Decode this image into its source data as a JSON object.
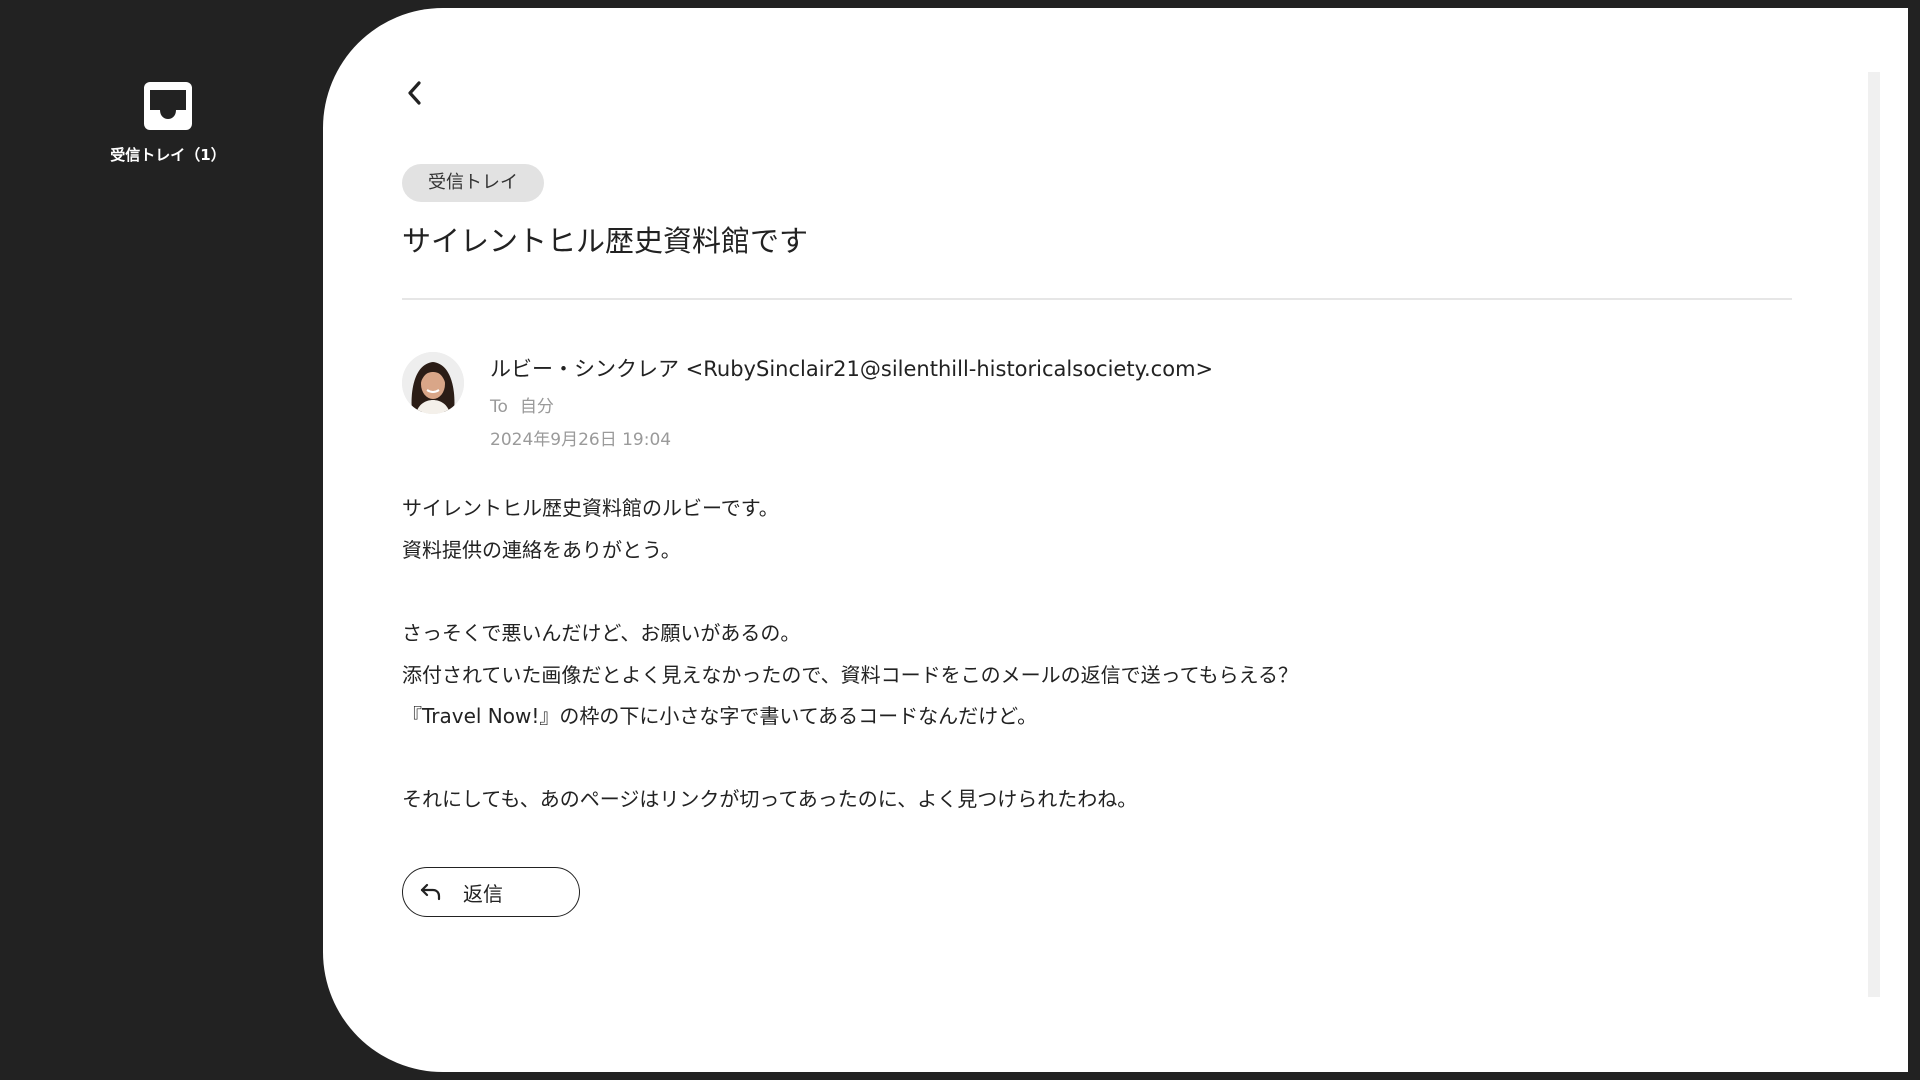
{
  "sidebar": {
    "inbox_label": "受信トレイ（1）"
  },
  "email": {
    "tag": "受信トレイ",
    "subject": "サイレントヒル歴史資料館です",
    "sender": "ルビー・シンクレア <RubySinclair21@silenthill-historicalsociety.com>",
    "to_prefix": "To",
    "to_recipient": "自分",
    "date": "2024年9月26日 19:04",
    "body": [
      "サイレントヒル歴史資料館のルビーです。",
      "資料提供の連絡をありがとう。",
      "",
      "さっそくで悪いんだけど、お願いがあるの。",
      "添付されていた画像だとよく見えなかったので、資料コードをこのメールの返信で送ってもらえる？",
      "『Travel Now!』の枠の下に小さな字で書いてあるコードなんだけど。",
      "",
      "それにしても、あのページはリンクが切ってあったのに、よく見つけられたわね。"
    ]
  },
  "actions": {
    "reply_label": "返信"
  },
  "icons": {
    "inbox": "inbox-tray-icon",
    "back": "chevron-left-icon",
    "reply": "reply-arrow-icon"
  }
}
